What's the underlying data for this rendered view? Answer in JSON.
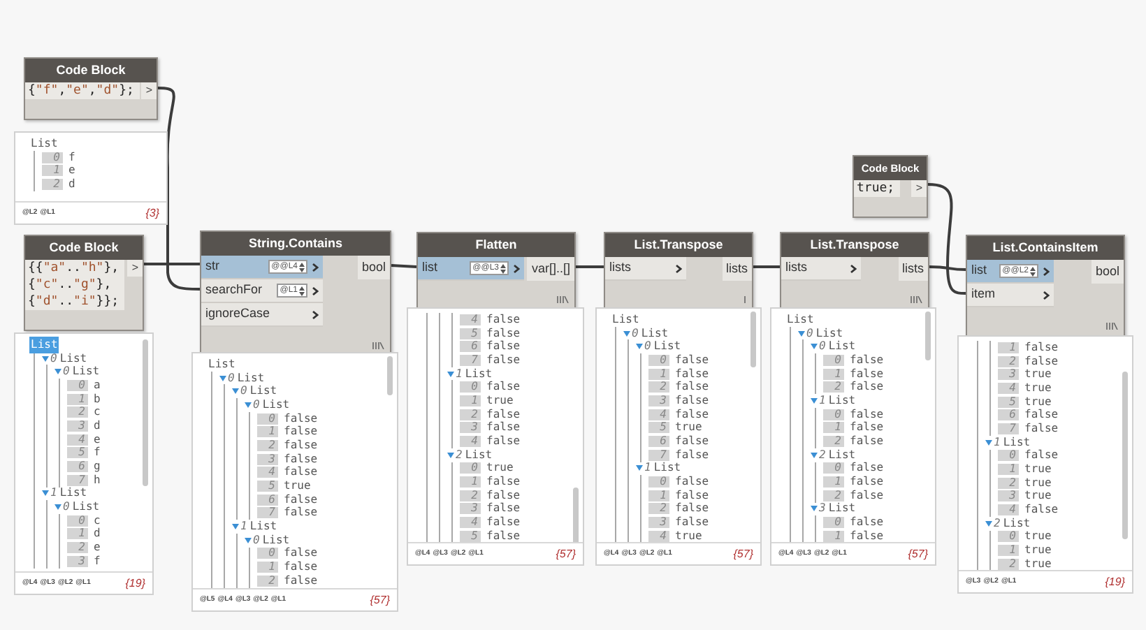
{
  "nodes": [
    {
      "kind": "code",
      "title": "Code Block",
      "code": [
        "{\"f\",\"e\",\"d\"};"
      ],
      "outputs": [
        ">"
      ],
      "preview": {
        "items": [
          {
            "label": "List",
            "selected": false,
            "children": [
              {
                "index": "0",
                "value": "f"
              },
              {
                "index": "1",
                "value": "e"
              },
              {
                "index": "2",
                "value": "d"
              }
            ]
          }
        ],
        "levels": [
          "@L2",
          "@L1"
        ],
        "count": "{3}"
      }
    },
    {
      "kind": "code",
      "title": "Code Block",
      "code": [
        "{{\"a\"..\"h\"},",
        "{\"c\"..\"g\"},",
        "{\"d\"..\"i\"}};"
      ],
      "outputs": [
        ">"
      ],
      "preview": {
        "items": [
          {
            "label": "List",
            "selected": true,
            "children": [
              {
                "index": "0",
                "label": "List",
                "children": [
                  {
                    "index": "0",
                    "label": "List",
                    "children": [
                      {
                        "index": "0",
                        "value": "a"
                      },
                      {
                        "index": "1",
                        "value": "b"
                      },
                      {
                        "index": "2",
                        "value": "c"
                      },
                      {
                        "index": "3",
                        "value": "d"
                      },
                      {
                        "index": "4",
                        "value": "e"
                      },
                      {
                        "index": "5",
                        "value": "f"
                      },
                      {
                        "index": "6",
                        "value": "g"
                      },
                      {
                        "index": "7",
                        "value": "h"
                      }
                    ]
                  }
                ]
              },
              {
                "index": "1",
                "label": "List",
                "children": [
                  {
                    "index": "0",
                    "label": "List",
                    "children": [
                      {
                        "index": "0",
                        "value": "c"
                      },
                      {
                        "index": "1",
                        "value": "d"
                      },
                      {
                        "index": "2",
                        "value": "e"
                      },
                      {
                        "index": "3",
                        "value": "f"
                      }
                    ]
                  }
                ]
              }
            ]
          }
        ],
        "levels": [
          "@L4",
          "@L3",
          "@L2",
          "@L1"
        ],
        "count": "{19}"
      }
    },
    {
      "kind": "function",
      "title": "String.Contains",
      "lacing": {
        "kind": "cross"
      },
      "inputs": [
        {
          "label": "str",
          "level": "@@L4",
          "highlighted": true
        },
        {
          "label": "searchFor",
          "level": "@L1",
          "highlighted": false
        },
        {
          "label": "ignoreCase",
          "highlighted": false
        }
      ],
      "outputs": [
        "bool"
      ],
      "preview": {
        "items": [
          {
            "label": "List",
            "selected": false,
            "children": [
              {
                "index": "0",
                "label": "List",
                "children": [
                  {
                    "index": "0",
                    "label": "List",
                    "children": [
                      {
                        "index": "0",
                        "label": "List",
                        "children": [
                          {
                            "index": "0",
                            "value": "false"
                          },
                          {
                            "index": "1",
                            "value": "false"
                          },
                          {
                            "index": "2",
                            "value": "false"
                          },
                          {
                            "index": "3",
                            "value": "false"
                          },
                          {
                            "index": "4",
                            "value": "false"
                          },
                          {
                            "index": "5",
                            "value": "true"
                          },
                          {
                            "index": "6",
                            "value": "false"
                          },
                          {
                            "index": "7",
                            "value": "false"
                          }
                        ]
                      }
                    ]
                  },
                  {
                    "index": "1",
                    "label": "List",
                    "children": [
                      {
                        "index": "0",
                        "label": "List",
                        "children": [
                          {
                            "index": "0",
                            "value": "false"
                          },
                          {
                            "index": "1",
                            "value": "false"
                          },
                          {
                            "index": "2",
                            "value": "false"
                          }
                        ]
                      }
                    ]
                  }
                ]
              }
            ]
          }
        ],
        "levels": [
          "@L5",
          "@L4",
          "@L3",
          "@L2",
          "@L1"
        ],
        "count": "{57}"
      }
    },
    {
      "kind": "function",
      "title": "Flatten",
      "lacing": {
        "kind": "cross"
      },
      "inputs": [
        {
          "label": "list",
          "level": "@@L3",
          "highlighted": true
        }
      ],
      "outputs": [
        "var[]..[]"
      ],
      "preview": {
        "items": [
          {
            "children": [
              {
                "children": [
                  {
                    "children": [
                      {
                        "index": "4",
                        "value": "false"
                      },
                      {
                        "index": "5",
                        "value": "false"
                      },
                      {
                        "index": "6",
                        "value": "false"
                      },
                      {
                        "index": "7",
                        "value": "false"
                      }
                    ]
                  },
                  {
                    "index": "1",
                    "label": "List",
                    "children": [
                      {
                        "index": "0",
                        "value": "false"
                      },
                      {
                        "index": "1",
                        "value": "true"
                      },
                      {
                        "index": "2",
                        "value": "false"
                      },
                      {
                        "index": "3",
                        "value": "false"
                      },
                      {
                        "index": "4",
                        "value": "false"
                      }
                    ]
                  },
                  {
                    "index": "2",
                    "label": "List",
                    "children": [
                      {
                        "index": "0",
                        "value": "true"
                      },
                      {
                        "index": "1",
                        "value": "false"
                      },
                      {
                        "index": "2",
                        "value": "false"
                      },
                      {
                        "index": "3",
                        "value": "false"
                      },
                      {
                        "index": "4",
                        "value": "false"
                      },
                      {
                        "index": "5",
                        "value": "false"
                      }
                    ]
                  }
                ]
              }
            ]
          }
        ],
        "levels": [
          "@L4",
          "@L3",
          "@L2",
          "@L1"
        ],
        "count": "{57}"
      }
    },
    {
      "kind": "function",
      "title": "List.Transpose",
      "lacing": {
        "kind": "shortest"
      },
      "inputs": [
        {
          "label": "lists",
          "highlighted": false
        }
      ],
      "outputs": [
        "lists"
      ],
      "preview": {
        "items": [
          {
            "label": "List",
            "selected": false,
            "children": [
              {
                "index": "0",
                "label": "List",
                "children": [
                  {
                    "index": "0",
                    "label": "List",
                    "children": [
                      {
                        "index": "0",
                        "value": "false"
                      },
                      {
                        "index": "1",
                        "value": "false"
                      },
                      {
                        "index": "2",
                        "value": "false"
                      },
                      {
                        "index": "3",
                        "value": "false"
                      },
                      {
                        "index": "4",
                        "value": "false"
                      },
                      {
                        "index": "5",
                        "value": "true"
                      },
                      {
                        "index": "6",
                        "value": "false"
                      },
                      {
                        "index": "7",
                        "value": "false"
                      }
                    ]
                  },
                  {
                    "index": "1",
                    "label": "List",
                    "children": [
                      {
                        "index": "0",
                        "value": "false"
                      },
                      {
                        "index": "1",
                        "value": "false"
                      },
                      {
                        "index": "2",
                        "value": "false"
                      },
                      {
                        "index": "3",
                        "value": "false"
                      },
                      {
                        "index": "4",
                        "value": "true"
                      }
                    ]
                  }
                ]
              }
            ]
          }
        ],
        "levels": [
          "@L4",
          "@L3",
          "@L2",
          "@L1"
        ],
        "count": "{57}"
      }
    },
    {
      "kind": "code",
      "title": "Code Block",
      "code": [
        "true;"
      ],
      "outputs": [
        ">"
      ]
    },
    {
      "kind": "function",
      "title": "List.Transpose",
      "lacing": {
        "kind": "cross"
      },
      "inputs": [
        {
          "label": "lists",
          "highlighted": false
        }
      ],
      "outputs": [
        "lists"
      ],
      "preview": {
        "items": [
          {
            "label": "List",
            "selected": false,
            "children": [
              {
                "index": "0",
                "label": "List",
                "children": [
                  {
                    "index": "0",
                    "label": "List",
                    "children": [
                      {
                        "index": "0",
                        "value": "false"
                      },
                      {
                        "index": "1",
                        "value": "false"
                      },
                      {
                        "index": "2",
                        "value": "false"
                      }
                    ]
                  },
                  {
                    "index": "1",
                    "label": "List",
                    "children": [
                      {
                        "index": "0",
                        "value": "false"
                      },
                      {
                        "index": "1",
                        "value": "false"
                      },
                      {
                        "index": "2",
                        "value": "false"
                      }
                    ]
                  },
                  {
                    "index": "2",
                    "label": "List",
                    "children": [
                      {
                        "index": "0",
                        "value": "false"
                      },
                      {
                        "index": "1",
                        "value": "false"
                      },
                      {
                        "index": "2",
                        "value": "false"
                      }
                    ]
                  },
                  {
                    "index": "3",
                    "label": "List",
                    "children": [
                      {
                        "index": "0",
                        "value": "false"
                      },
                      {
                        "index": "1",
                        "value": "false"
                      }
                    ]
                  }
                ]
              }
            ]
          }
        ],
        "levels": [
          "@L4",
          "@L3",
          "@L2",
          "@L1"
        ],
        "count": "{57}"
      }
    },
    {
      "kind": "function",
      "title": "List.ContainsItem",
      "lacing": {
        "kind": "cross"
      },
      "inputs": [
        {
          "label": "list",
          "level": "@@L2",
          "highlighted": true
        },
        {
          "label": "item",
          "highlighted": false
        }
      ],
      "outputs": [
        "bool"
      ],
      "preview": {
        "items": [
          {
            "children": [
              {
                "children": [
                  {
                    "index": "1",
                    "value": "false"
                  },
                  {
                    "index": "2",
                    "value": "false"
                  },
                  {
                    "index": "3",
                    "value": "true"
                  },
                  {
                    "index": "4",
                    "value": "true"
                  },
                  {
                    "index": "5",
                    "value": "true"
                  },
                  {
                    "index": "6",
                    "value": "false"
                  },
                  {
                    "index": "7",
                    "value": "false"
                  }
                ]
              },
              {
                "index": "1",
                "label": "List",
                "children": [
                  {
                    "index": "0",
                    "value": "false"
                  },
                  {
                    "index": "1",
                    "value": "true"
                  },
                  {
                    "index": "2",
                    "value": "true"
                  },
                  {
                    "index": "3",
                    "value": "true"
                  },
                  {
                    "index": "4",
                    "value": "false"
                  }
                ]
              },
              {
                "index": "2",
                "label": "List",
                "children": [
                  {
                    "index": "0",
                    "value": "true"
                  },
                  {
                    "index": "1",
                    "value": "true"
                  },
                  {
                    "index": "2",
                    "value": "true"
                  }
                ]
              }
            ]
          }
        ],
        "levels": [
          "@L3",
          "@L2",
          "@L1"
        ],
        "count": "{19}"
      }
    }
  ]
}
